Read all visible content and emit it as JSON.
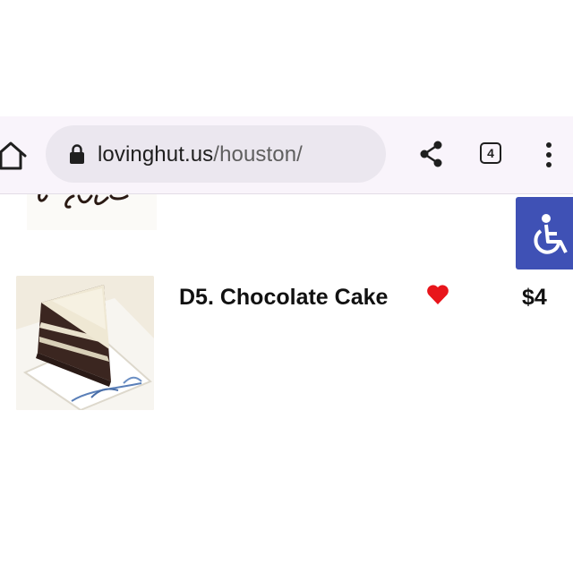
{
  "browser": {
    "url_host": "lovinghut.us",
    "url_path": "/houston/",
    "tab_count": "4"
  },
  "icons": {
    "home": "home-icon",
    "lock": "lock-icon",
    "share": "share-icon",
    "menu": "more-vert-icon",
    "accessibility": "wheelchair-icon",
    "favorite": "heart-icon"
  },
  "colors": {
    "toolbar_bg": "#f9f4fb",
    "urlbar_bg": "#ebe7ef",
    "accessibility_bg": "#3f51b5",
    "heart": "#e8151b"
  },
  "menu_item": {
    "name": "D5. Chocolate Cake",
    "price": "$4"
  }
}
